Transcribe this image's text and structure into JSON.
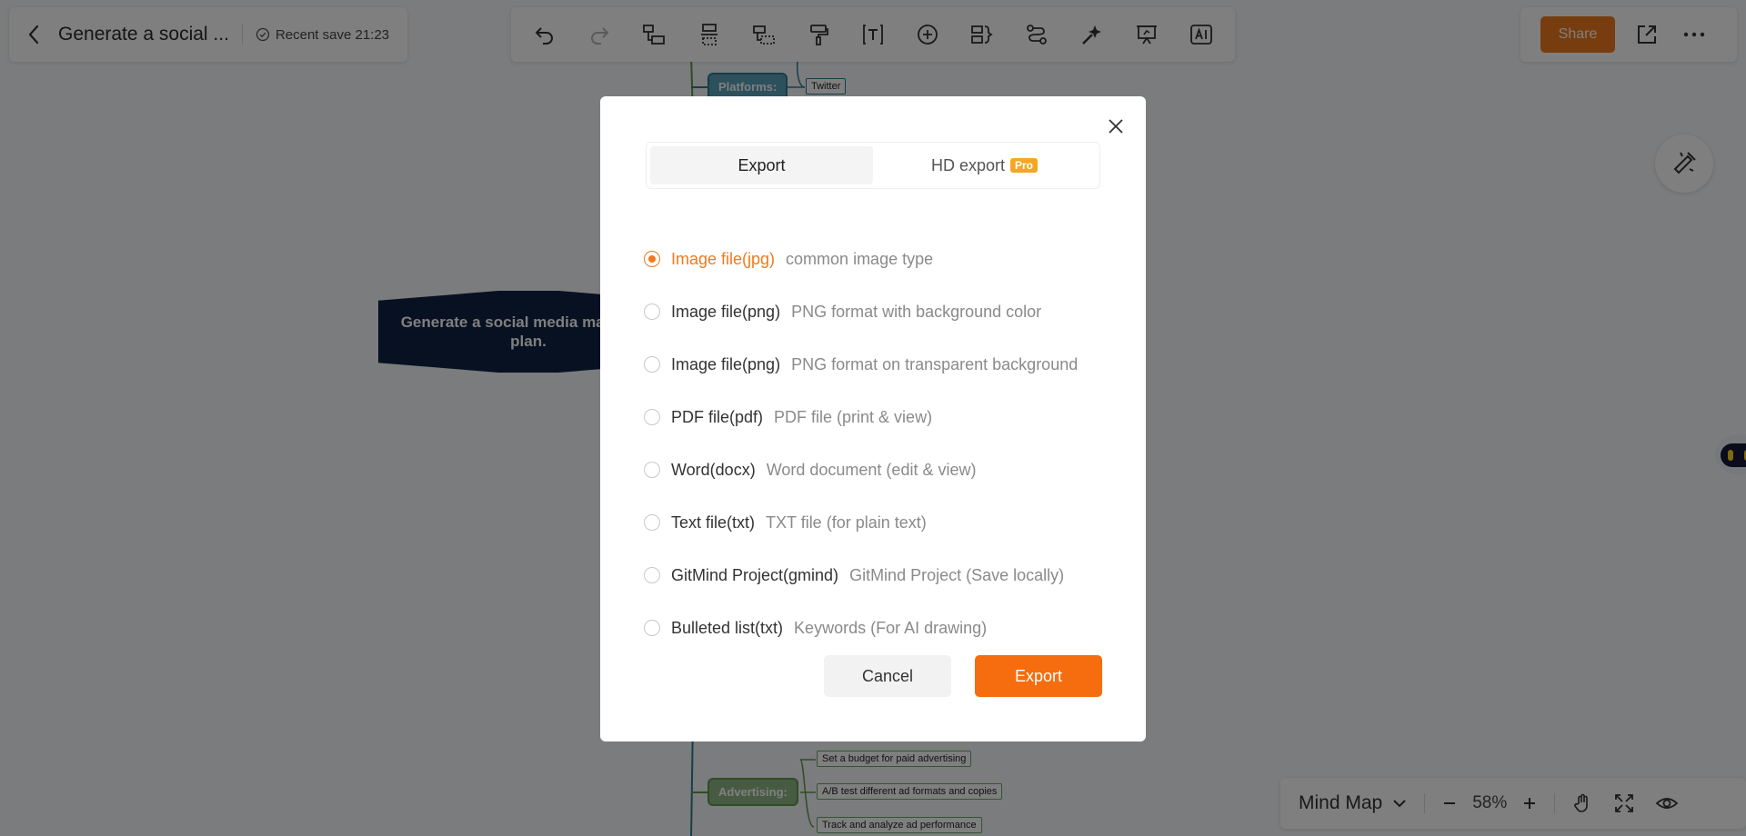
{
  "header": {
    "doc_title": "Generate a social ...",
    "save_status": "Recent save 21:23",
    "share_label": "Share"
  },
  "canvas": {
    "root_text": "Generate a social media marketing plan.",
    "branch_platforms": "Platforms:",
    "branch_advertising": "Advertising:",
    "leaf_twitter": "Twitter",
    "leaf_budget": "Set a budget for paid advertising",
    "leaf_abtest": "A/B test different ad formats and copies",
    "leaf_track": "Track and analyze ad performance"
  },
  "bottom_bar": {
    "view_label": "Mind Map",
    "zoom": "58%"
  },
  "export_dialog": {
    "tabs": [
      {
        "label": "Export",
        "active": true
      },
      {
        "label": "HD export",
        "badge": "Pro",
        "active": false
      }
    ],
    "options": [
      {
        "name": "Image file(jpg)",
        "desc": "common image type",
        "selected": true
      },
      {
        "name": "Image file(png)",
        "desc": "PNG format with background color",
        "selected": false
      },
      {
        "name": "Image file(png)",
        "desc": "PNG format on transparent background",
        "selected": false
      },
      {
        "name": "PDF file(pdf)",
        "desc": "PDF file (print & view)",
        "selected": false
      },
      {
        "name": "Word(docx)",
        "desc": "Word document (edit & view)",
        "selected": false
      },
      {
        "name": "Text file(txt)",
        "desc": "TXT file (for plain text)",
        "selected": false
      },
      {
        "name": "GitMind Project(gmind)",
        "desc": "GitMind Project (Save locally)",
        "selected": false
      },
      {
        "name": "Bulleted list(txt)",
        "desc": "Keywords (For AI drawing)",
        "selected": false
      }
    ],
    "cancel_label": "Cancel",
    "export_label": "Export"
  },
  "icons": {
    "toolbar": [
      "undo-icon",
      "redo-icon",
      "insert-child-icon",
      "insert-sibling-icon",
      "insert-parent-icon",
      "format-painter-icon",
      "text-icon",
      "add-icon",
      "summary-icon",
      "relation-icon",
      "style-icon",
      "presentation-icon",
      "ai-icon"
    ]
  },
  "colors": {
    "accent": "#f56d0f",
    "root_node": "#0f2344",
    "overlay": "rgba(0,0,0,0.5)"
  }
}
